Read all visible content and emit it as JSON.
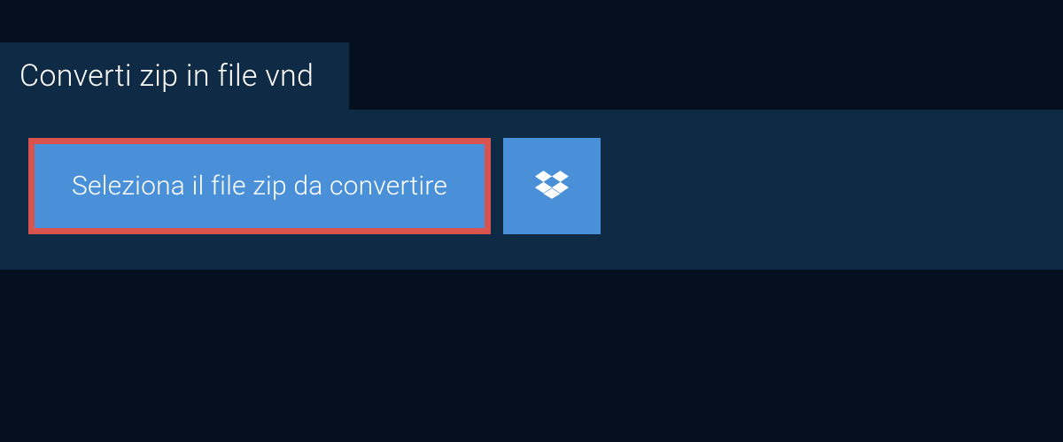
{
  "tab": {
    "title": "Converti zip in file vnd"
  },
  "panel": {
    "select_button_label": "Seleziona il file zip da convertire"
  },
  "colors": {
    "background": "#05101f",
    "panel": "#0f2a44",
    "button": "#4a90d9",
    "highlight_border": "#d9534f",
    "text": "#ffffff"
  }
}
